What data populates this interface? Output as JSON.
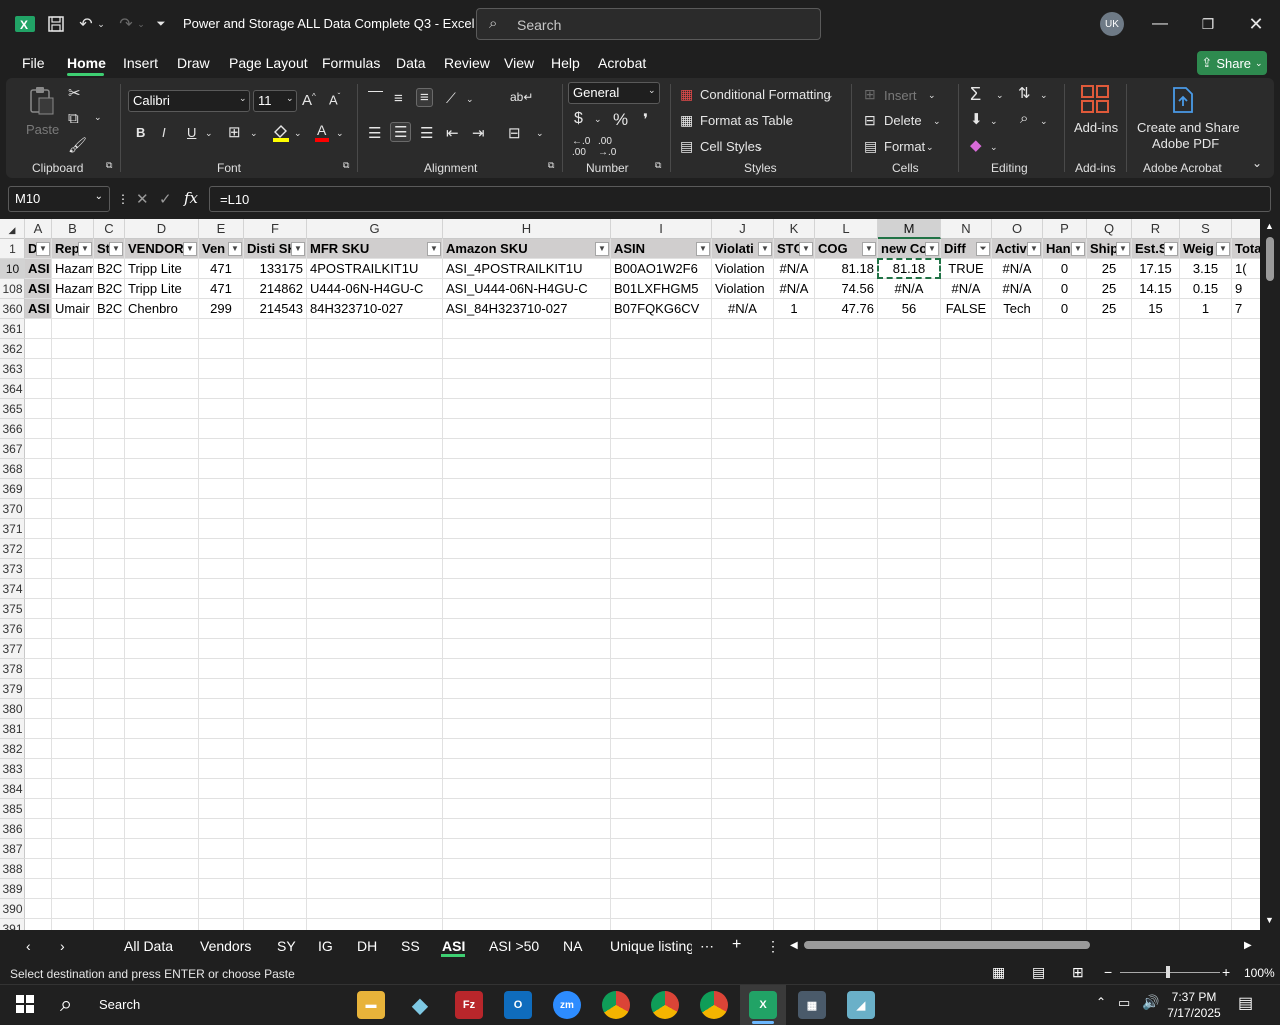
{
  "window": {
    "title": "Power and Storage ALL Data Complete Q3  -  Excel",
    "search_placeholder": "Search",
    "avatar_initials": "UK",
    "share_label": "Share"
  },
  "menu": [
    "File",
    "Home",
    "Insert",
    "Draw",
    "Page Layout",
    "Formulas",
    "Data",
    "Review",
    "View",
    "Help",
    "Acrobat"
  ],
  "ribbon": {
    "clipboard": {
      "label": "Clipboard",
      "paste": "Paste"
    },
    "font": {
      "label": "Font",
      "name": "Calibri",
      "size": "11",
      "bold": "B",
      "italic": "I",
      "underline": "U"
    },
    "alignment": {
      "label": "Alignment"
    },
    "number": {
      "label": "Number",
      "format": "General"
    },
    "styles": {
      "label": "Styles",
      "conditional": "Conditional Formatting",
      "format_table": "Format as Table",
      "cell_styles": "Cell Styles"
    },
    "cells": {
      "label": "Cells",
      "insert": "Insert",
      "delete": "Delete",
      "format": "Format"
    },
    "editing": {
      "label": "Editing"
    },
    "addins": {
      "label": "Add-ins",
      "button": "Add-ins"
    },
    "acrobat": {
      "label": "Adobe Acrobat",
      "button_line1": "Create and Share",
      "button_line2": "Adobe PDF"
    }
  },
  "formula_bar": {
    "name_box": "M10",
    "formula": "=L10"
  },
  "columns": [
    "A",
    "B",
    "C",
    "D",
    "E",
    "F",
    "G",
    "H",
    "I",
    "J",
    "K",
    "L",
    "M",
    "N",
    "O",
    "P",
    "Q",
    "R",
    "S"
  ],
  "header_row": {
    "row": "1",
    "cells": [
      "D",
      "Rep",
      "St",
      "VENDOR",
      "Ven",
      "Disti SK",
      "MFR SKU",
      "Amazon SKU",
      "ASIN",
      "Violati",
      "STC",
      "COG",
      "new Co",
      "Diff",
      "Activ",
      "Han",
      "Ship",
      "Est.S",
      "Weig",
      "Tota"
    ]
  },
  "rows": [
    {
      "row": "10",
      "cells": [
        "ASI",
        "Hazam",
        "B2C",
        "Tripp Lite",
        "471",
        "133175",
        "4POSTRAILKIT1U",
        "ASI_4POSTRAILKIT1U",
        "B00AO1W2F6",
        "Violation",
        "#N/A",
        "81.18",
        "81.18",
        "TRUE",
        "#N/A",
        "0",
        "25",
        "17.15",
        "3.15",
        "1("
      ]
    },
    {
      "row": "108",
      "cells": [
        "ASI",
        "Hazam",
        "B2C",
        "Tripp Lite",
        "471",
        "214862",
        "U444-06N-H4GU-C",
        "ASI_U444-06N-H4GU-C",
        "B01LXFHGM5",
        "Violation",
        "#N/A",
        "74.56",
        "#N/A",
        "#N/A",
        "#N/A",
        "0",
        "25",
        "14.15",
        "0.15",
        "9"
      ]
    },
    {
      "row": "360",
      "cells": [
        "ASI",
        "Umair",
        "B2C",
        "Chenbro",
        "299",
        "214543",
        "84H323710-027",
        "ASI_84H323710-027",
        "B07FQKG6CV",
        "#N/A",
        "1",
        "47.76",
        "56",
        "FALSE",
        "Tech",
        "0",
        "25",
        "15",
        "1",
        "7"
      ]
    }
  ],
  "empty_rows": [
    "361",
    "362",
    "363",
    "364",
    "365",
    "366",
    "367",
    "368",
    "369",
    "370",
    "371",
    "372",
    "373",
    "374",
    "375",
    "376",
    "377",
    "378",
    "379",
    "380",
    "381",
    "382",
    "383",
    "384",
    "385",
    "386",
    "387",
    "388",
    "389",
    "390",
    "391"
  ],
  "sheets": [
    "All Data",
    "Vendors",
    "SY",
    "IG",
    "DH",
    "SS",
    "ASI",
    "ASI >50",
    "NA",
    "Unique listing"
  ],
  "active_sheet": "ASI",
  "status": {
    "message": "Select destination and press ENTER or choose Paste",
    "zoom": "100%"
  },
  "taskbar": {
    "search": "Search",
    "time": "7:37 PM",
    "date": "7/17/2025"
  }
}
